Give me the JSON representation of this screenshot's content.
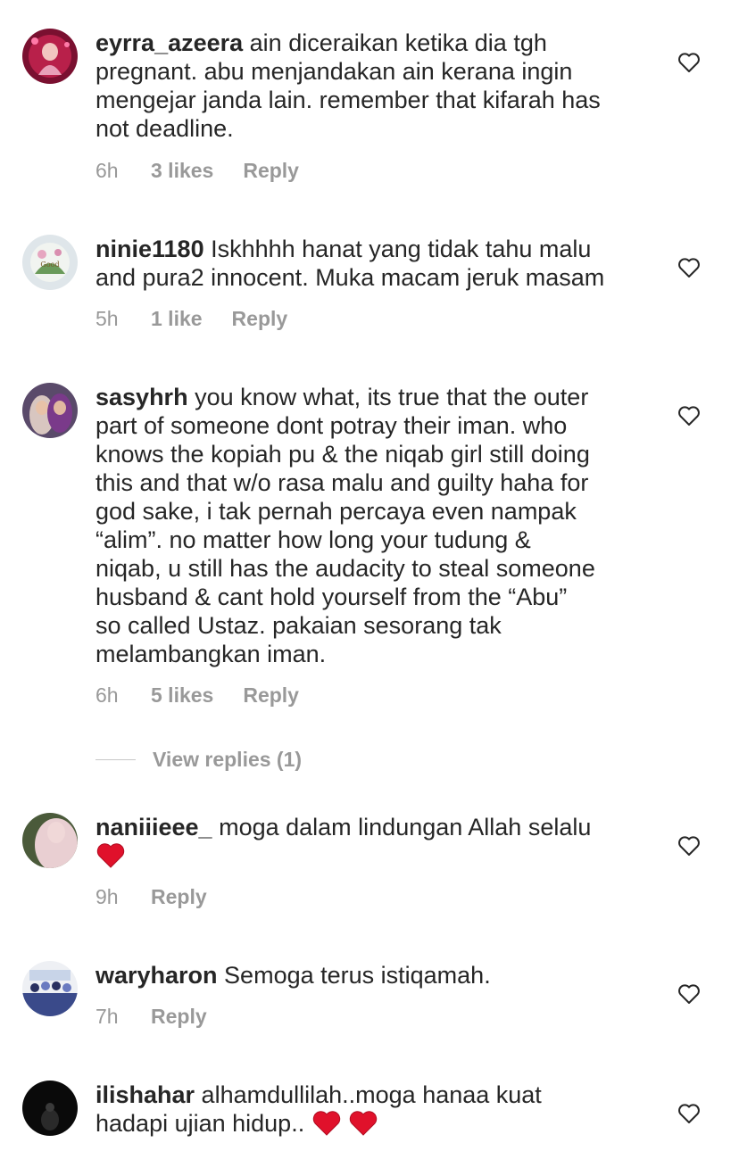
{
  "comments": [
    {
      "username": "eyrra_azeera",
      "text": " ain diceraikan ketika dia tgh\npregnant. abu menjandakan ain kerana ingin\nmengejar janda lain. remember that kifarah has\nnot deadline.",
      "time": "6h",
      "likes": "3 likes",
      "reply": "Reply"
    },
    {
      "username": "ninie1180",
      "text": " Iskhhhh hanat yang tidak tahu malu\nand pura2 innocent. Muka macam jeruk masam",
      "time": "5h",
      "likes": "1 like",
      "reply": "Reply"
    },
    {
      "username": "sasyhrh",
      "text": " you know what, its true that the outer\npart of someone dont potray their iman. who\nknows the kopiah pu & the niqab girl still doing\nthis and that w/o rasa malu and guilty haha for\ngod sake, i tak pernah percaya even nampak\n“alim”. no matter how long your tudung &\nniqab, u still has the audacity to steal someone\nhusband & cant hold yourself from the “Abu”\nso called Ustaz. pakaian sesorang tak\nmelambangkan iman.",
      "time": "6h",
      "likes": "5 likes",
      "reply": "Reply"
    },
    {
      "username": "naniiieee_",
      "text": " moga dalam lindungan Allah selalu\n",
      "time": "9h",
      "reply": "Reply"
    },
    {
      "username": "waryharon",
      "text": " Semoga terus istiqamah.",
      "time": "7h",
      "reply": "Reply"
    },
    {
      "username": "ilishahar",
      "text": " alhamdullilah..moga hanaa kuat\nhadapi ujian hidup.. ",
      "time": "",
      "reply": ""
    }
  ],
  "view_replies": "View replies (1)",
  "icons": {
    "like": "heart-outline-icon",
    "emoji": "red-heart-emoji"
  },
  "colors": {
    "text": "#262626",
    "secondary": "#999999",
    "emoji_red": "#e0112b"
  }
}
